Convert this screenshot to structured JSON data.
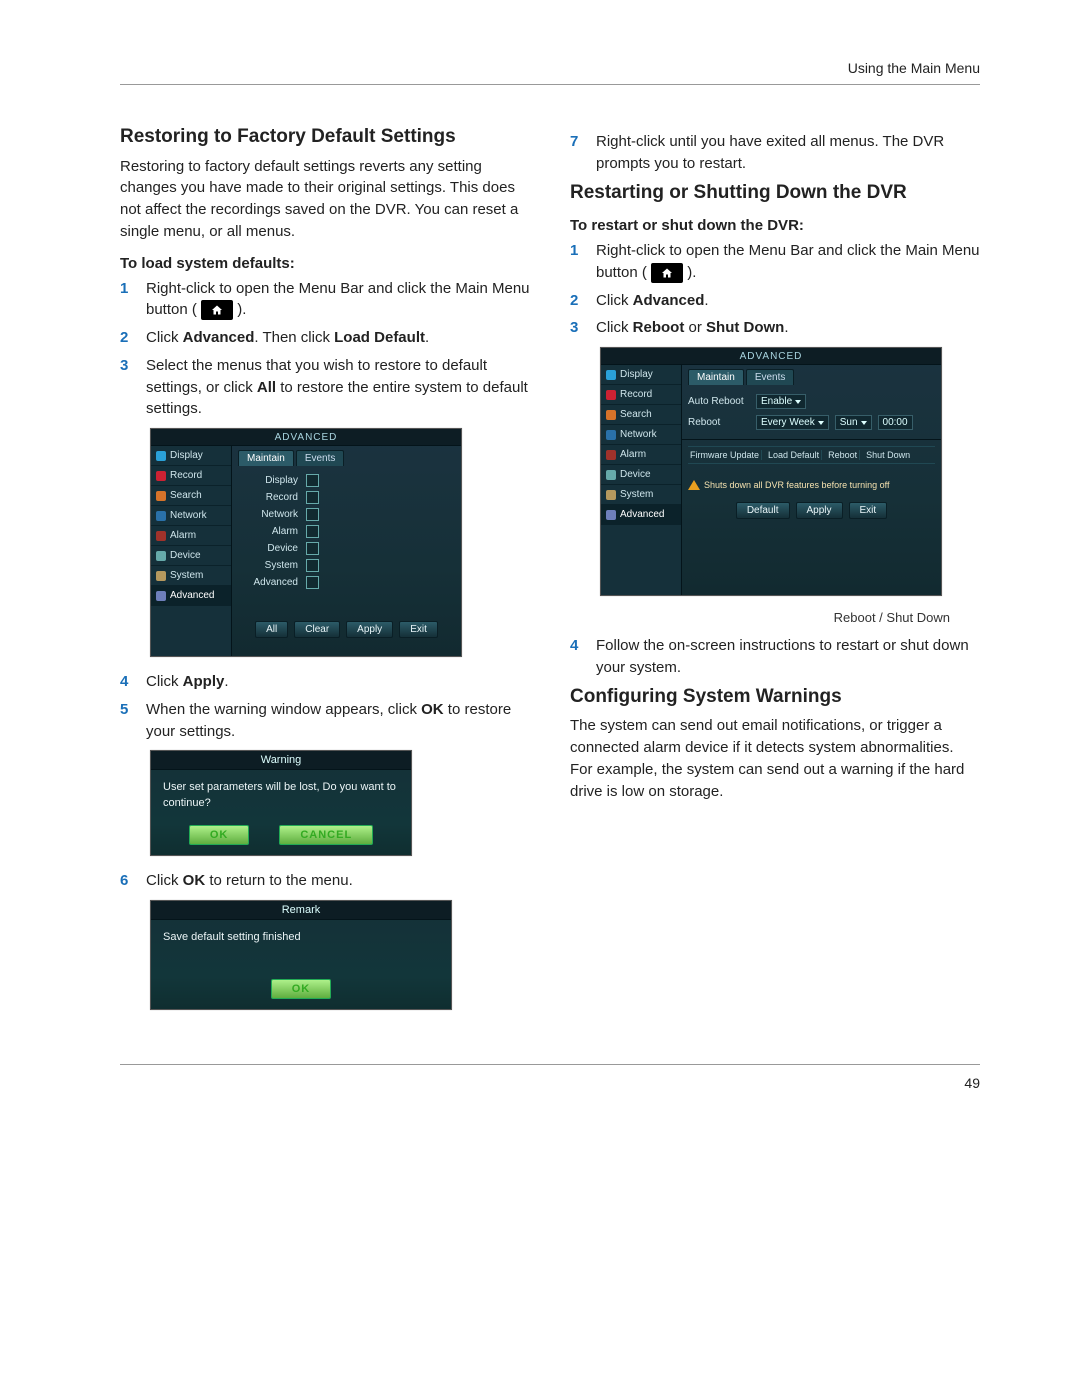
{
  "header": {
    "text": "Using the Main Menu"
  },
  "page_number": "49",
  "left": {
    "h1": "Restoring to Factory Default Settings",
    "intro": "Restoring to factory default settings reverts any setting changes you have made to their original settings. This does not affect the recordings saved on the DVR. You can reset a single menu, or all menus.",
    "sub1": "To load system defaults:",
    "step1a": "Right-click to open the Menu Bar and click the Main Menu button (",
    "step1b": ").",
    "step2_a": "Click ",
    "step2_b": "Advanced",
    "step2_c": ". Then click ",
    "step2_d": "Load Default",
    "step2_e": ".",
    "step3_a": "Select the menus that you wish to restore to default settings, or click ",
    "step3_b": "All",
    "step3_c": " to restore the entire system to default settings.",
    "adv_title": "ADVANCED",
    "adv_sidebar": [
      "Display",
      "Record",
      "Search",
      "Network",
      "Alarm",
      "Device",
      "System",
      "Advanced"
    ],
    "adv_tabs": [
      "Maintain",
      "Events"
    ],
    "adv_checks": [
      "Display",
      "Record",
      "Network",
      "Alarm",
      "Device",
      "System",
      "Advanced"
    ],
    "adv_buttons": [
      "All",
      "Clear",
      "Apply",
      "Exit"
    ],
    "step4_a": "Click ",
    "step4_b": "Apply",
    "step4_c": ".",
    "step5_a": "When the warning window appears, click ",
    "step5_b": "OK",
    "step5_c": " to restore your settings.",
    "warn_title": "Warning",
    "warn_text": "User set parameters will be lost, Do you want to continue?",
    "warn_ok": "OK",
    "warn_cancel": "CANCEL",
    "step6_a": "Click ",
    "step6_b": "OK",
    "step6_c": " to return to the menu.",
    "remark_title": "Remark",
    "remark_text": "Save default setting finished",
    "remark_ok": "OK"
  },
  "right": {
    "step7": "Right-click until you have exited all menus. The DVR prompts you to restart.",
    "h1": "Restarting or Shutting Down the DVR",
    "sub1": "To restart or shut down the DVR:",
    "step1a": "Right-click to open the Menu Bar and click the Main Menu button (",
    "step1b": ").",
    "step2_a": "Click ",
    "step2_b": "Advanced",
    "step2_c": ".",
    "step3_a": "Click ",
    "step3_b": "Reboot",
    "step3_c": " or ",
    "step3_d": "Shut Down",
    "step3_e": ".",
    "adv_title": "ADVANCED",
    "adv_sidebar": [
      "Display",
      "Record",
      "Search",
      "Network",
      "Alarm",
      "Device",
      "System",
      "Advanced"
    ],
    "adv_tabs": [
      "Maintain",
      "Events"
    ],
    "auto_reboot_lbl": "Auto Reboot",
    "auto_reboot_val": "Enable",
    "reboot_lbl": "Reboot",
    "reboot_val1": "Every Week",
    "reboot_val2": "Sun",
    "reboot_val3": "00:00",
    "fn_labels": [
      "Firmware Update",
      "Load Default",
      "Reboot",
      "Shut Down"
    ],
    "warn_msg": "Shuts down all DVR features before turning off",
    "bottom_buttons": [
      "Default",
      "Apply",
      "Exit"
    ],
    "caption": "Reboot / Shut Down",
    "step4": "Follow the on-screen instructions to restart or shut down your system.",
    "h2": "Configuring System Warnings",
    "p2": "The system can send out email notifications, or trigger a connected alarm device if it detects system abnormalities. For example, the system can send out a warning if the hard drive is low on storage."
  }
}
